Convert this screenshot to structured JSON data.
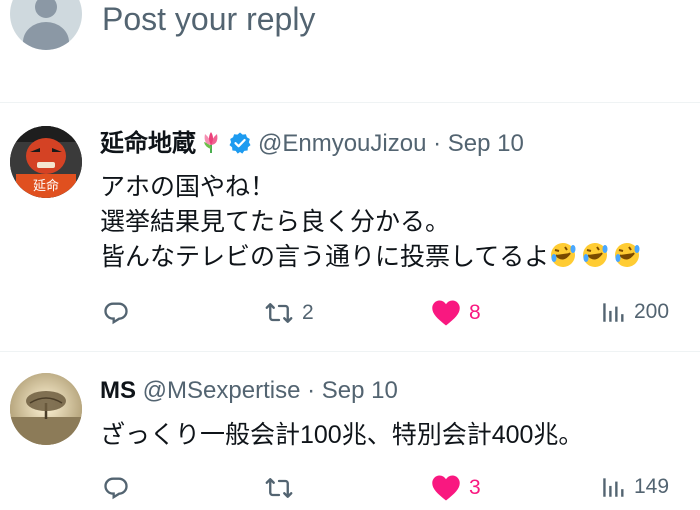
{
  "compose": {
    "placeholder": "Post your reply"
  },
  "tweets": [
    {
      "name": "延命地蔵",
      "handle": "@EnmyouJizou",
      "separator": "·",
      "date": "Sep 10",
      "verified": true,
      "name_emoji": "tulip",
      "lines": [
        "アホの国やね！",
        "選挙結果見てたら良く分かる。",
        "皆んなテレビの言う通りに投票してるよ"
      ],
      "trailing_emoji": "rolling-on-the-floor-laughing x3",
      "actions": {
        "reply": "",
        "repost": "2",
        "like": "8",
        "views": "200"
      },
      "liked": true
    },
    {
      "name": "MS",
      "handle": "@MSexpertise",
      "separator": "·",
      "date": "Sep 10",
      "verified": false,
      "lines": [
        "ざっくり一般会計100兆、特別会計400兆。"
      ],
      "actions": {
        "reply": "",
        "repost": "",
        "like": "3",
        "views": "149"
      },
      "liked": true
    }
  ],
  "colors": {
    "like": "#f91880",
    "verified": "#1d9bf0",
    "secondary_text": "#536471",
    "divider": "#eff3f4"
  }
}
